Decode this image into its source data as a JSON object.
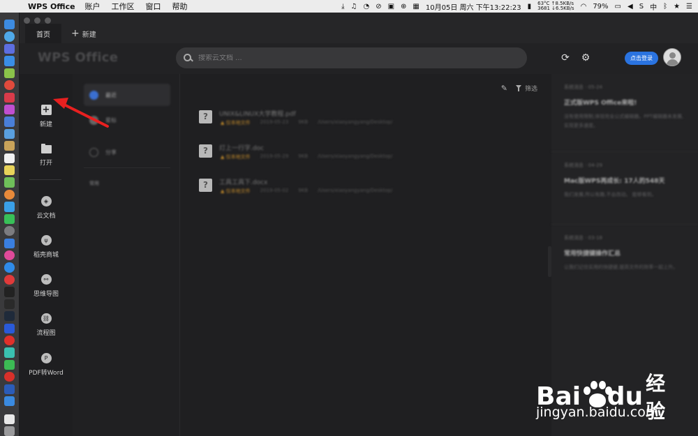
{
  "menubar": {
    "app_name": "WPS Office",
    "items": [
      "账户",
      "工作区",
      "窗口",
      "帮助"
    ],
    "temp": "63°C",
    "net_up": "↑8.5KB/s",
    "net_down": "↓6.5KB/s",
    "rpm": "3681",
    "datetime": "10月05日 周六 下午13:22:23",
    "battery": "79%",
    "input_method": "中"
  },
  "tabs": {
    "home": "首页",
    "new": "新建"
  },
  "header": {
    "logo": "WPS Office",
    "search_placeholder": "搜索云文档 ...",
    "login": "点击登录"
  },
  "leftnav": {
    "new": "新建",
    "open": "打开",
    "cloud": "云文档",
    "store": "稻壳商城",
    "mindmap": "思维导图",
    "flowchart": "流程图",
    "pdf2word": "PDF转Word"
  },
  "subnav": {
    "recent": "最近",
    "star": "星标",
    "share": "分享",
    "common": "常用"
  },
  "filelist": {
    "filter": "筛选",
    "files": [
      {
        "name": "UNIX&LINUX大学教程.pdf",
        "status": "▲ 仅本地文件",
        "date": "2019-05-23",
        "size": "9KB",
        "path": "/Users/xiaoyangyang/Desktop/"
      },
      {
        "name": "灯上一行字.doc",
        "status": "▲ 仅本地文件",
        "date": "2019-05-29",
        "size": "9KB",
        "path": "/Users/xiaoyangyang/Desktop/"
      },
      {
        "name": "工具工具下.docx",
        "status": "▲ 仅本地文件",
        "date": "2019-05-02",
        "size": "9KB",
        "path": "/Users/xiaoyangyang/Desktop/"
      }
    ]
  },
  "news": [
    {
      "tag": "系统消息 · 05-24",
      "title": "正式版WPS Office来啦!",
      "desc": "没有使用限制,体验完全公式编辑器。PPT编辑器未发展,实现更多速度。"
    },
    {
      "tag": "系统消息 · 04-29",
      "title": "Mac版WPS再成长: 17人的548天",
      "desc": "我们发展,所以有趣,不会改动。 能够看到。"
    },
    {
      "tag": "系统消息 · 03-18",
      "title": "常用快捷键操作汇总",
      "desc": "让我们记住实用的快捷键,提高文件的效率一起上升。"
    }
  ],
  "watermark": {
    "bai": "Bai",
    "du": "du",
    "cn": "经验",
    "url": "jingyan.baidu.com"
  }
}
